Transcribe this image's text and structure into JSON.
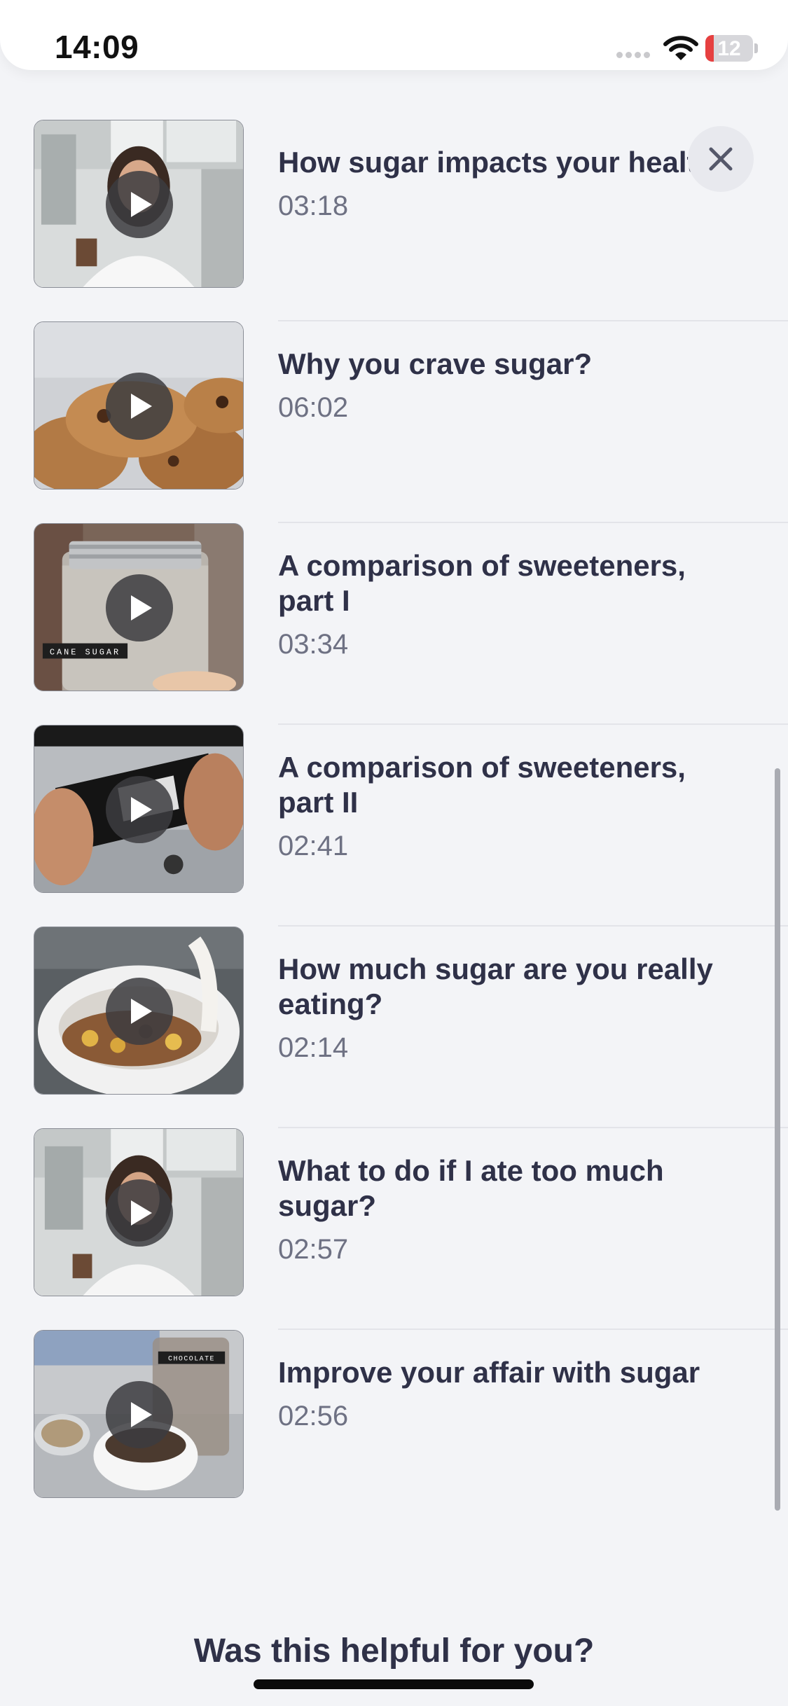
{
  "status_bar": {
    "time": "14:09",
    "battery_level": "12",
    "battery_color": "#e64040",
    "icons": [
      "signal-dots-icon",
      "wifi-icon",
      "battery-icon"
    ]
  },
  "close_button": {
    "icon": "close-icon"
  },
  "videos": [
    {
      "title": "How sugar impacts your health",
      "duration": "03:18",
      "thumbnail": "woman-kitchen"
    },
    {
      "title": "Why you crave sugar?",
      "duration": "06:02",
      "thumbnail": "cookies"
    },
    {
      "title": "A comparison of sweeteners, part I",
      "duration": "03:34",
      "thumbnail": "sugar-jar",
      "thumbnail_label": "CANE SUGAR"
    },
    {
      "title": "A comparison of sweeteners, part II",
      "duration": "02:41",
      "thumbnail": "snack-bar"
    },
    {
      "title": "How much sugar are you really eating?",
      "duration": "02:14",
      "thumbnail": "cereal-bowl"
    },
    {
      "title": "What to do if I ate too much sugar?",
      "duration": "02:57",
      "thumbnail": "woman-kitchen"
    },
    {
      "title": "Improve your affair with sugar",
      "duration": "02:56",
      "thumbnail": "chocolate",
      "thumbnail_label": "CHOCOLATE"
    }
  ],
  "feedback": {
    "question": "Was this helpful for you?"
  },
  "colors": {
    "accent_text": "#2f3148",
    "background": "#f3f4f7"
  }
}
